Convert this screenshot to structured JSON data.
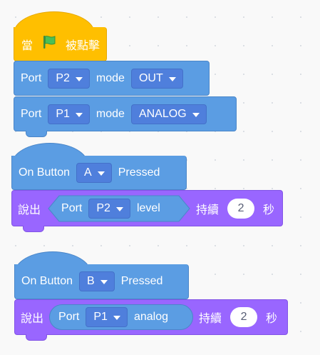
{
  "colors": {
    "motion_blue": "#5b9de3",
    "event_yellow": "#ffbf00",
    "looks_purple": "#9966ff",
    "dropdown_blue": "#4f7fdc",
    "flag_green": "#4cbf56"
  },
  "stack1": {
    "hat": {
      "prefix": "當",
      "icon": "green-flag-icon",
      "suffix": "被點擊"
    },
    "port_p2": {
      "label": "Port",
      "port_value": "P2",
      "mode_label": "mode",
      "mode_value": "OUT"
    },
    "port_p1": {
      "label": "Port",
      "port_value": "P1",
      "mode_label": "mode",
      "mode_value": "ANALOG"
    }
  },
  "stack2": {
    "hat": {
      "prefix": "On Button",
      "button_value": "A",
      "suffix": "Pressed"
    },
    "say": {
      "label": "說出",
      "reporter": {
        "label": "Port",
        "port_value": "P2",
        "suffix": "level"
      },
      "duration_label": "持續",
      "duration_value": "2",
      "unit": "秒"
    }
  },
  "stack3": {
    "hat": {
      "prefix": "On Button",
      "button_value": "B",
      "suffix": "Pressed"
    },
    "say": {
      "label": "說出",
      "reporter": {
        "label": "Port",
        "port_value": "P1",
        "suffix": "analog"
      },
      "duration_label": "持續",
      "duration_value": "2",
      "unit": "秒"
    }
  }
}
